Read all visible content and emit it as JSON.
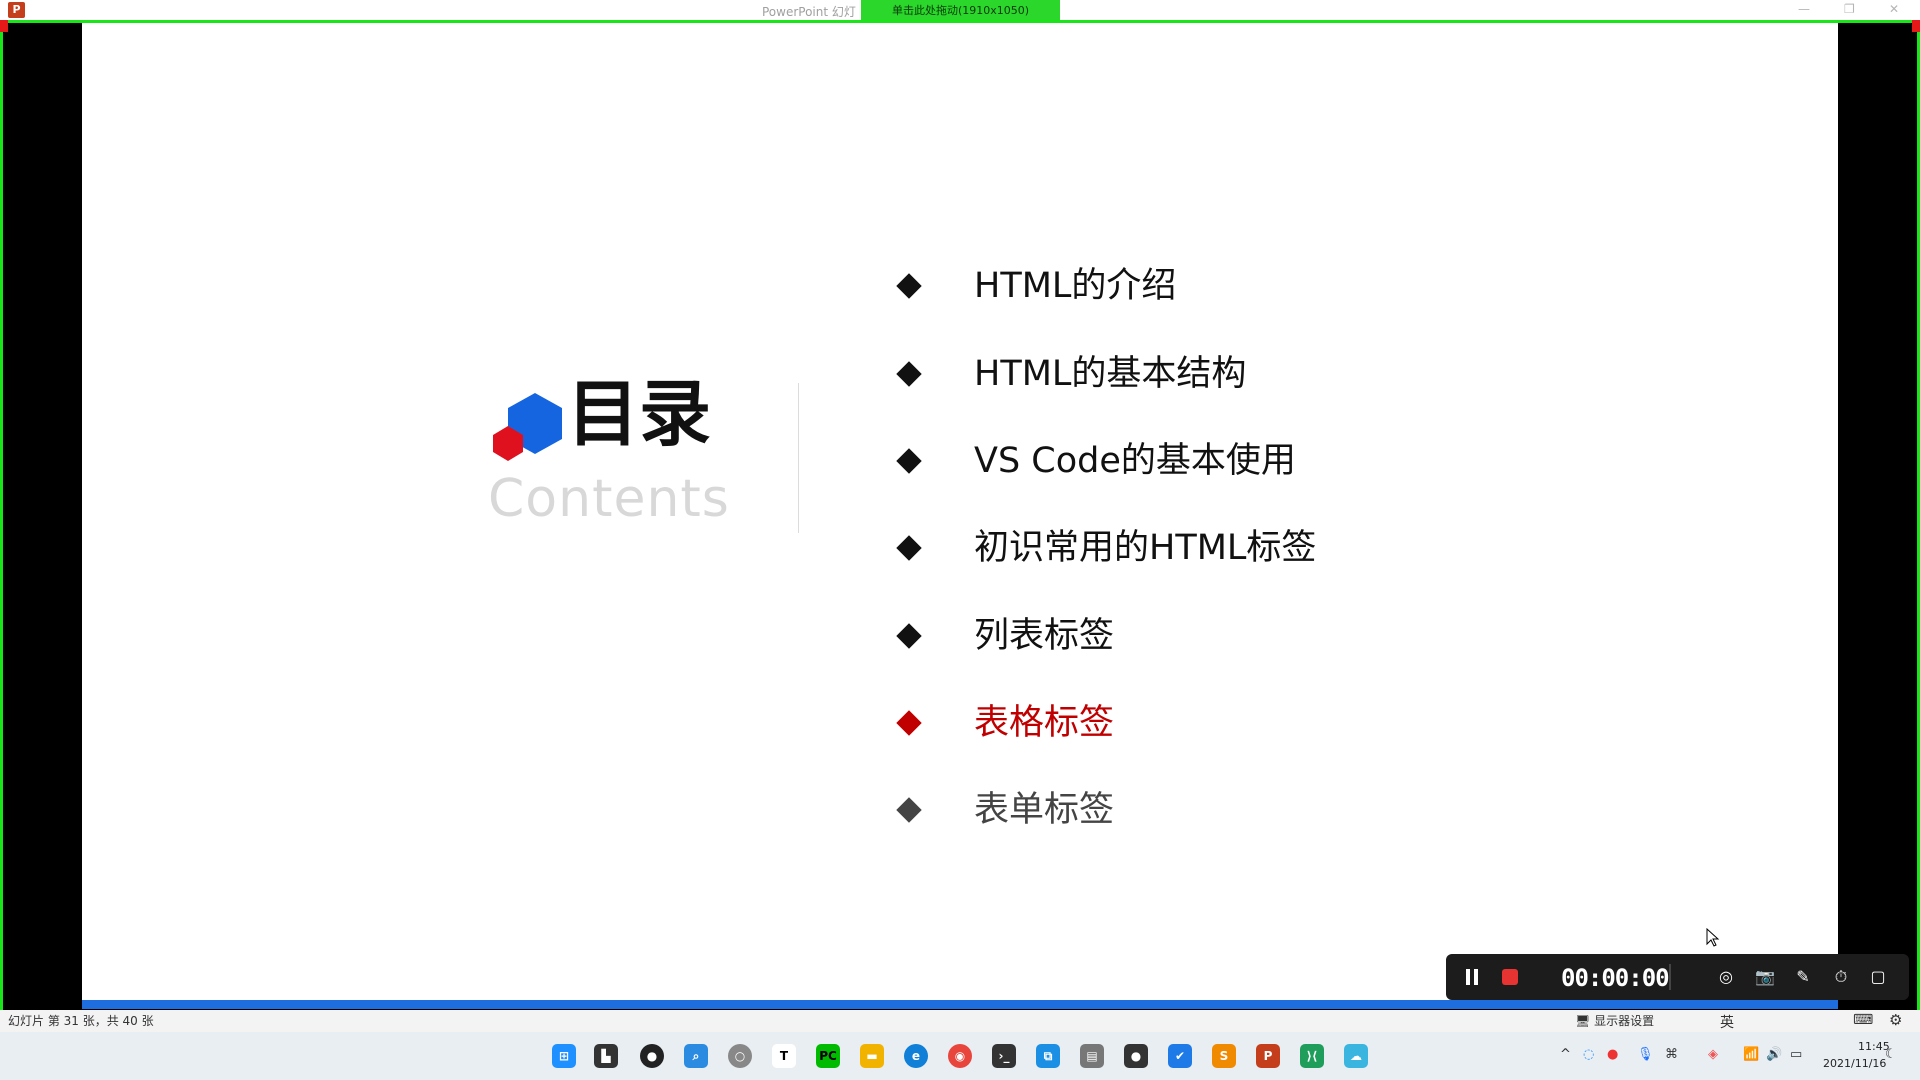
{
  "window": {
    "title": "PowerPoint 幻灯",
    "drag_banner": "单击此处拖动(1910x1050)",
    "minimize": "—",
    "restore": "❐",
    "close": "✕",
    "app_icon_letter": "P"
  },
  "slide": {
    "toc_title": "目录",
    "toc_subtitle": "Contents",
    "items": [
      {
        "label": "HTML的介绍",
        "color": "#111111"
      },
      {
        "label": "HTML的基本结构",
        "color": "#111111"
      },
      {
        "label": "VS Code的基本使用",
        "color": "#111111"
      },
      {
        "label": "初识常用的HTML标签",
        "color": "#111111"
      },
      {
        "label": "列表标签",
        "color": "#111111"
      },
      {
        "label": "表格标签",
        "color": "#c00000"
      },
      {
        "label": "表单标签",
        "color": "#444444"
      }
    ],
    "logo_colors": {
      "blue": "#1565e0",
      "red": "#e0111e"
    }
  },
  "status": {
    "slide_info": "幻灯片 第 31 张，共 40 张",
    "monitor_settings": "显示器设置"
  },
  "recorder": {
    "timer": "00:00:00"
  },
  "taskbar": {
    "ime_lang": "英",
    "time": "11:45",
    "date": "2021/11/16"
  }
}
